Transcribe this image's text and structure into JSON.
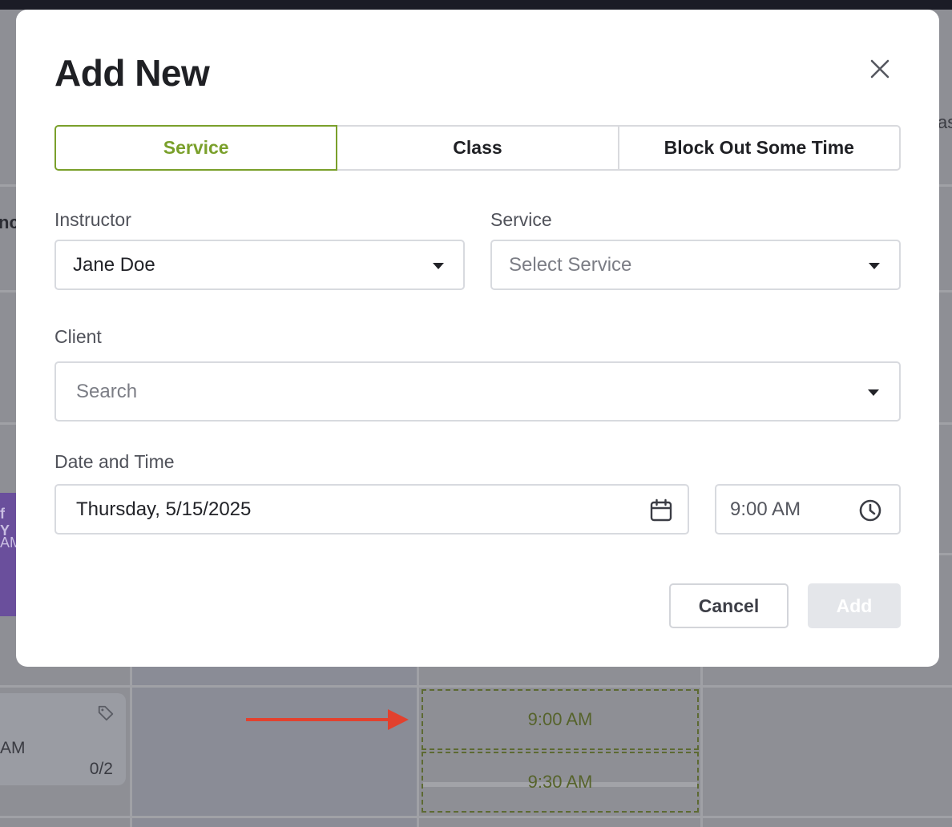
{
  "background": {
    "slots": [
      "9:00 AM",
      "9:30 AM"
    ],
    "card": {
      "time_fragment": "AM",
      "capacity": "0/2"
    },
    "edge_fragments": [
      "nc",
      "f Y",
      "AM",
      "as"
    ]
  },
  "modal": {
    "title": "Add New",
    "tabs": [
      {
        "label": "Service",
        "active": true
      },
      {
        "label": "Class",
        "active": false
      },
      {
        "label": "Block Out Some Time",
        "active": false
      }
    ],
    "instructor": {
      "label": "Instructor",
      "value": "Jane Doe"
    },
    "service": {
      "label": "Service",
      "placeholder": "Select Service"
    },
    "client": {
      "label": "Client",
      "placeholder": "Search"
    },
    "date_time": {
      "label": "Date and Time",
      "date": "Thursday, 5/15/2025",
      "time": "9:00 AM"
    },
    "buttons": {
      "cancel": "Cancel",
      "add": "Add"
    }
  },
  "colors": {
    "accent": "#7aa02b",
    "arrow": "#e2412e",
    "overlay": "#8e8f95",
    "add_disabled": "#e4e6ea"
  }
}
